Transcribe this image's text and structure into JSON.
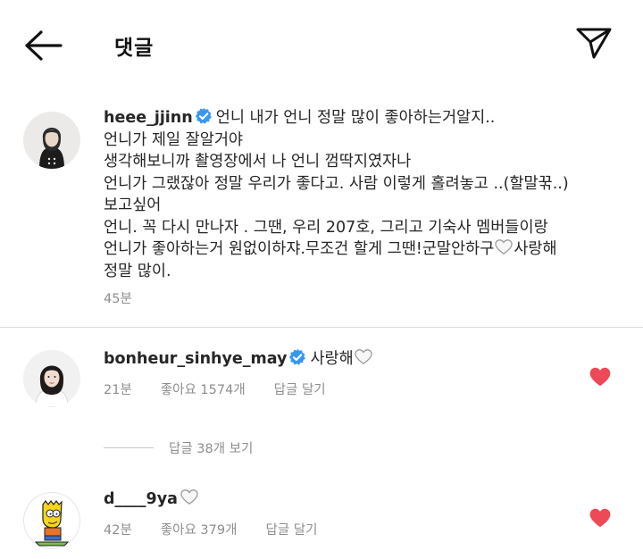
{
  "header": {
    "title": "댓글",
    "back_icon": "arrow-left-icon",
    "share_icon": "paper-plane-icon"
  },
  "caption": {
    "username": "heee_jjinn",
    "verified": true,
    "lines": [
      "언니 내가 언니 정말 많이 좋아하는거알지..",
      "언니가 제일 잘알거야",
      "생각해보니까 촬영장에서 나 언니 껌딱지였자나",
      "언니가 그랬잖아 정말 우리가 좋다고. 사람 이렇게 홀려놓고 ..(할말꾺..)",
      "보고싶어",
      "언니. 꼭 다시 만나자 . 그땐, 우리 207호, 그리고 기숙사 멤버들이랑",
      "언니가 좋아하는거 원없이하쟈.무조건 할게 그땐!군말안하구",
      "정말 많이."
    ],
    "line7_suffix": "사랑해",
    "time": "45분"
  },
  "comments": [
    {
      "username": "bonheur_sinhye_may",
      "verified": true,
      "text": "사랑해",
      "time": "21분",
      "likes": "좋아요 1574개",
      "reply_label": "답글 달기",
      "liked": true,
      "view_replies": "답글 38개 보기"
    },
    {
      "username": "d____9ya",
      "verified": false,
      "text": "",
      "time": "42분",
      "likes": "좋아요 379개",
      "reply_label": "답글 달기",
      "liked": true
    }
  ],
  "colors": {
    "verified_blue": "#3897f0",
    "like_red": "#ed4956",
    "meta_gray": "#8e8e8e"
  }
}
